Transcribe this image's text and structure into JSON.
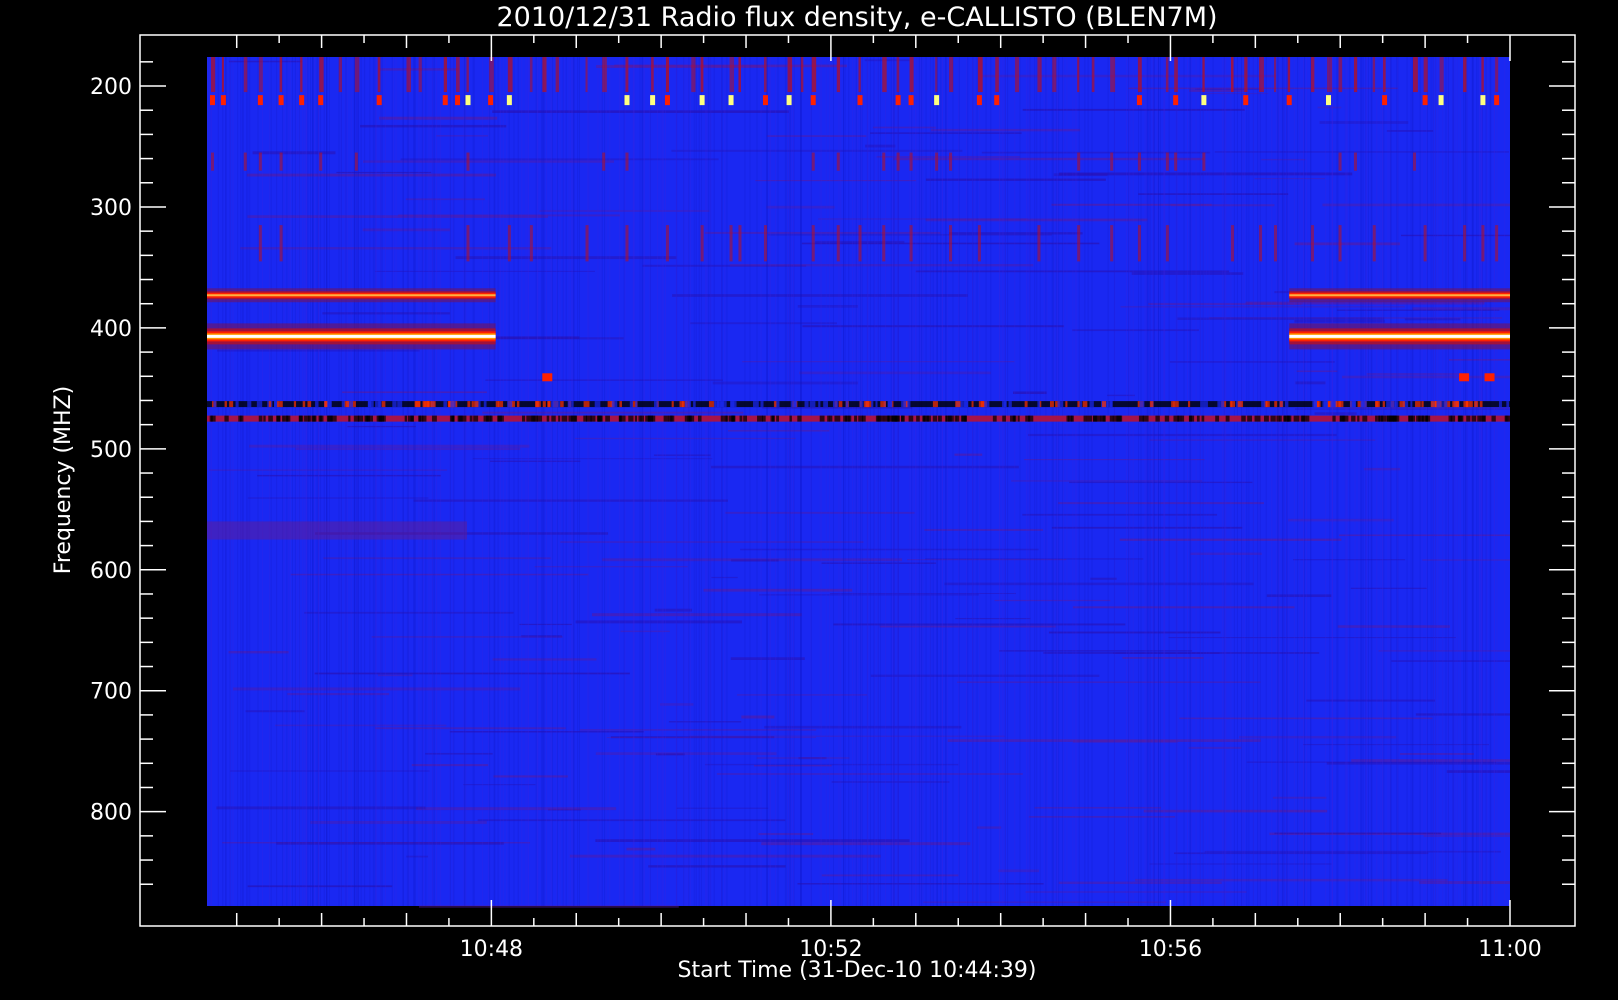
{
  "chart_data": {
    "type": "heatmap",
    "title": "2010/12/31  Radio flux density, e-CALLISTO (BLEN7M)",
    "xlabel": "Start Time (31-Dec-10 10:44:39)",
    "ylabel": "Frequency (MHZ)",
    "x_axis": {
      "unit": "time",
      "range": [
        "10:44:39",
        "11:00:00"
      ],
      "ticks": [
        {
          "value": "10:48",
          "minutes": 648
        },
        {
          "value": "10:52",
          "minutes": 652
        },
        {
          "value": "10:56",
          "minutes": 656
        },
        {
          "value": "11:00",
          "minutes": 660
        }
      ]
    },
    "y_axis": {
      "unit": "MHz",
      "range": [
        878,
        176
      ],
      "inverted": true,
      "ticks": [
        200,
        300,
        400,
        500,
        600,
        700,
        800
      ]
    },
    "colormap": [
      "#000000",
      "#3a10c8",
      "#1a2af0",
      "#b0102a",
      "#ff2000",
      "#ff9a00",
      "#ffff80",
      "#ffffff"
    ],
    "background_color": "#1a28f2",
    "features": [
      {
        "kind": "band",
        "label": "strong emission",
        "freq_mhz": 373,
        "time_range": [
          "10:44:39",
          "10:48:03"
        ],
        "intensity": "high"
      },
      {
        "kind": "band",
        "label": "strong emission",
        "freq_mhz": 407,
        "time_range": [
          "10:44:39",
          "10:48:03"
        ],
        "intensity": "very high"
      },
      {
        "kind": "band",
        "label": "strong emission",
        "freq_mhz": 373,
        "time_range": [
          "10:57:24",
          "11:00:00"
        ],
        "intensity": "high"
      },
      {
        "kind": "band",
        "label": "strong emission",
        "freq_mhz": 407,
        "time_range": [
          "10:57:24",
          "11:00:00"
        ],
        "intensity": "very high"
      },
      {
        "kind": "line",
        "label": "dark interference",
        "freq_mhz": 463,
        "time_range": [
          "10:44:39",
          "11:00:00"
        ]
      },
      {
        "kind": "line",
        "label": "red interference",
        "freq_mhz": 475,
        "time_range": [
          "10:44:39",
          "11:00:00"
        ]
      },
      {
        "kind": "spikes",
        "label": "intermittent bursts",
        "freq_range_mhz": [
          176,
          230
        ],
        "time_range": [
          "10:44:39",
          "11:00:00"
        ]
      }
    ]
  }
}
